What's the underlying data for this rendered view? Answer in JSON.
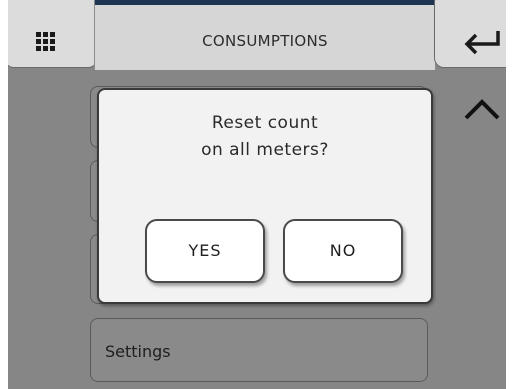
{
  "header": {
    "title": "CONSUMPTIONS",
    "menu_icon": "grid-menu-icon",
    "back_icon": "return-arrow-icon",
    "up_icon": "chevron-up-icon",
    "accent_color": "#1d3550"
  },
  "list": {
    "visible_item_label": "Settings"
  },
  "dialog": {
    "message_line1": "Reset count",
    "message_line2": "on all meters?",
    "yes_label": "YES",
    "no_label": "NO"
  }
}
